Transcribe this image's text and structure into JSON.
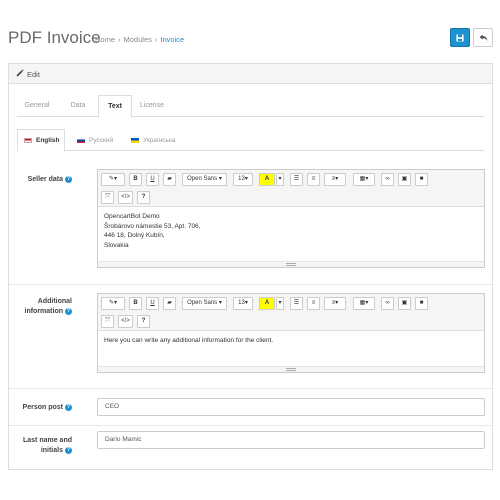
{
  "header": {
    "title": "PDF Invoice",
    "breadcrumbs": [
      "Home",
      "Modules",
      "Invoice"
    ],
    "save_icon": "save-icon",
    "back_icon": "reply-icon",
    "accent_color": "#1e91cf"
  },
  "panel": {
    "title": "Edit",
    "title_icon": "pencil-icon",
    "tabs": [
      {
        "label": "General",
        "active": false
      },
      {
        "label": "Data",
        "active": false
      },
      {
        "label": "Text",
        "active": true
      },
      {
        "label": "License",
        "active": false
      }
    ],
    "language_tabs": [
      {
        "label": "English",
        "flag": "uk-flag-icon",
        "active": true
      },
      {
        "label": "Русский",
        "flag": "ru-flag-icon",
        "active": false
      },
      {
        "label": "Українська",
        "flag": "ua-flag-icon",
        "active": false
      }
    ]
  },
  "toolbar": {
    "font_name": "Open Sans",
    "font_size": "13",
    "buttons": [
      "magic-icon",
      "bold-icon",
      "underline-icon",
      "eraser-icon",
      "font-name-dropdown",
      "font-size-dropdown",
      "text-color-icon",
      "unordered-list-icon",
      "ordered-list-icon",
      "align-icon",
      "table-icon",
      "link-icon",
      "image-icon",
      "video-icon",
      "fullscreen-icon",
      "code-view-icon",
      "help-icon"
    ],
    "labels": {
      "bold": "B",
      "underline": "U",
      "text_color": "A",
      "code": "</>",
      "help": "?"
    }
  },
  "form": {
    "seller_data": {
      "label": "Seller data",
      "lines": [
        "OpencartBot Demo",
        "Šrobárovo námestie 53, Apt. 706,",
        "446 18, Dolný Kubín,",
        "Slovakia"
      ]
    },
    "additional_information": {
      "label_line1": "Additional",
      "label_line2": "information",
      "text": "Here you can write any additional information for the client."
    },
    "person_post": {
      "label": "Person post",
      "value": "CEO"
    },
    "last_name_initials": {
      "label_line1": "Last name and",
      "label_line2": "initials",
      "value": "Dario Mamic"
    }
  }
}
